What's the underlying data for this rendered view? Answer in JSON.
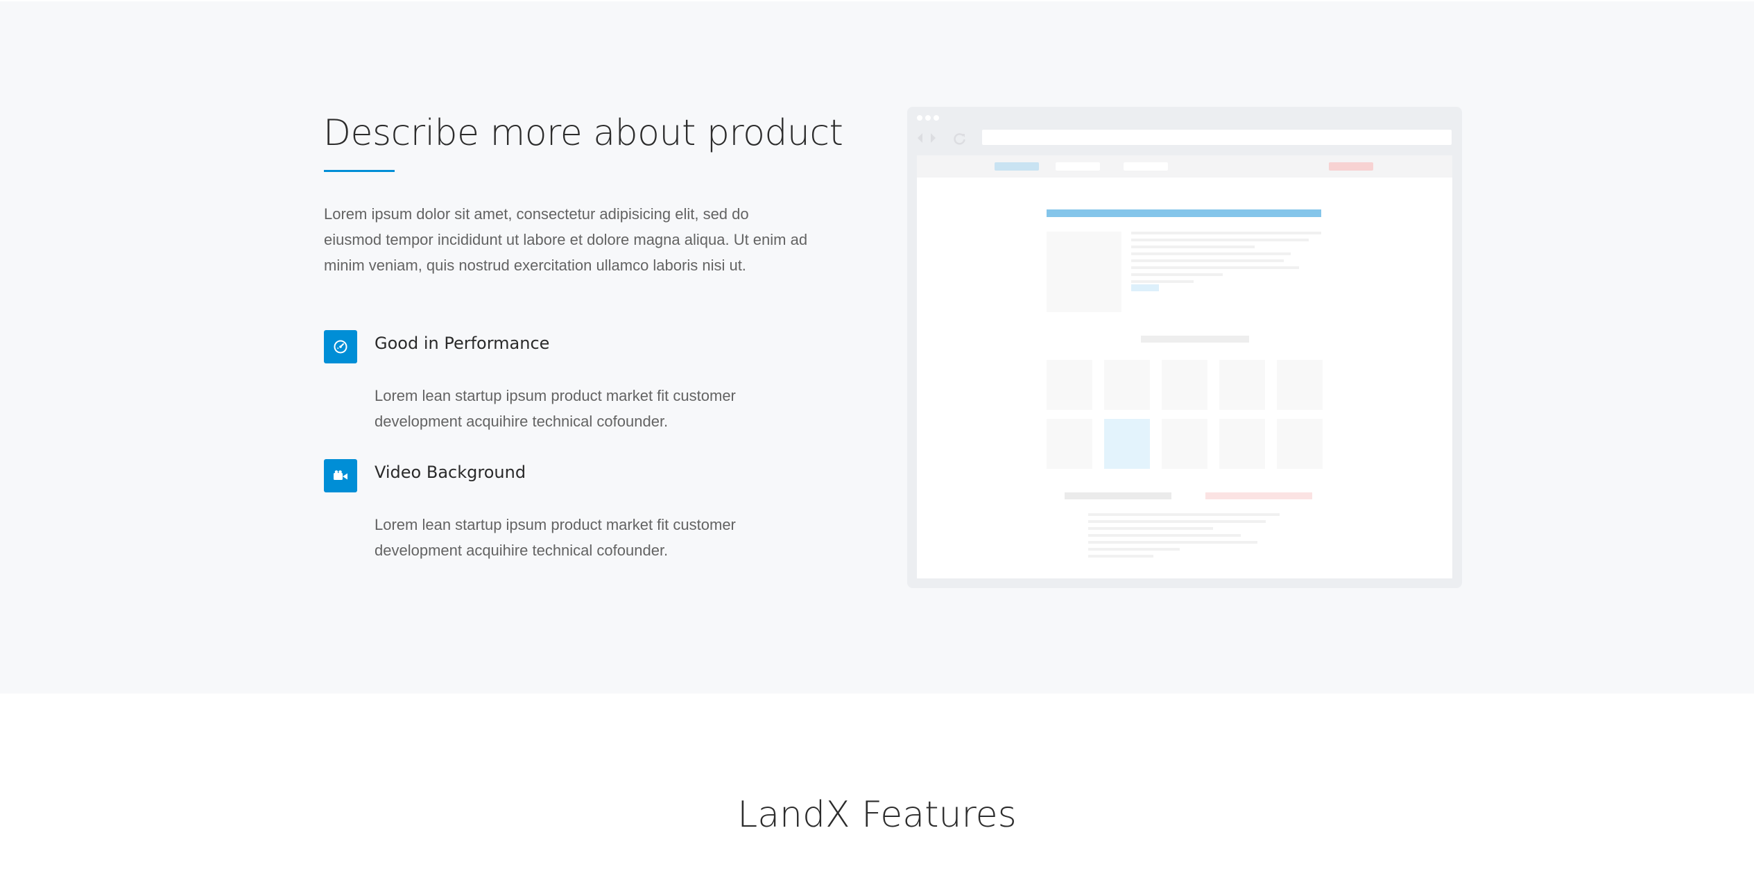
{
  "hero": {
    "title": "Describe more about product",
    "intro": "Lorem ipsum dolor sit amet, consectetur adipisicing elit, sed do eiusmod tempor incididunt ut labore et dolore magna aliqua. Ut enim ad minim veniam, quis nostrud exercitation ullamco laboris nisi ut."
  },
  "features": [
    {
      "icon": "speedometer-icon",
      "title": "Good in Performance",
      "description": "Lorem lean startup ipsum product market fit customer development acquihire technical cofounder."
    },
    {
      "icon": "video-camera-icon",
      "title": "Video Background",
      "description": "Lorem lean startup ipsum product market fit customer development acquihire technical cofounder."
    }
  ],
  "next_section": {
    "title": "LandX Features"
  },
  "colors": {
    "accent": "#008ed6",
    "section_background": "#f7f8fa",
    "heading_text": "#2c2c2c",
    "body_text": "#636363"
  }
}
